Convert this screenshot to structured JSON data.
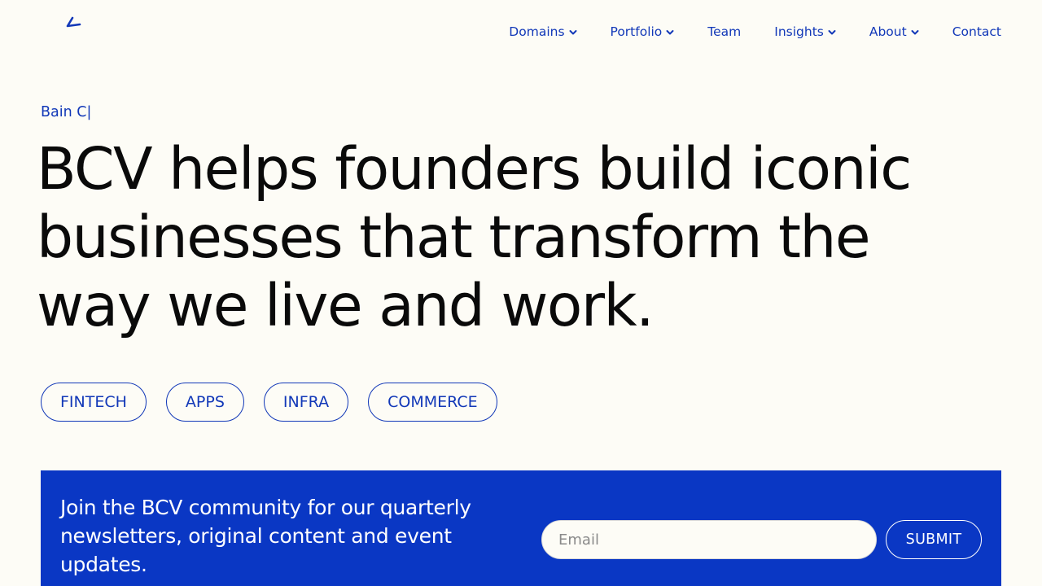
{
  "logo": {
    "icon": "bcv-logo-mark",
    "color": "#1238b8"
  },
  "nav": {
    "items": [
      {
        "label": "Domains",
        "has_dropdown": true
      },
      {
        "label": "Portfolio",
        "has_dropdown": true
      },
      {
        "label": "Team",
        "has_dropdown": false
      },
      {
        "label": "Insights",
        "has_dropdown": true
      },
      {
        "label": "About",
        "has_dropdown": true
      },
      {
        "label": "Contact",
        "has_dropdown": false
      }
    ]
  },
  "hero": {
    "eyebrow": "Bain C|",
    "headline": "BCV helps founders build iconic businesses that transform the way we live and work."
  },
  "domains": {
    "pills": [
      "FINTECH",
      "APPS",
      "INFRA",
      "COMMERCE"
    ]
  },
  "newsletter": {
    "text": "Join the BCV community for our quarterly newsletters, original content and event updates.",
    "email_placeholder": "Email",
    "submit_label": "SUBMIT",
    "background": "#0a37c4"
  },
  "colors": {
    "accent": "#1238b8",
    "page_background": "#fdfcf6",
    "text": "#0a0a0a"
  }
}
